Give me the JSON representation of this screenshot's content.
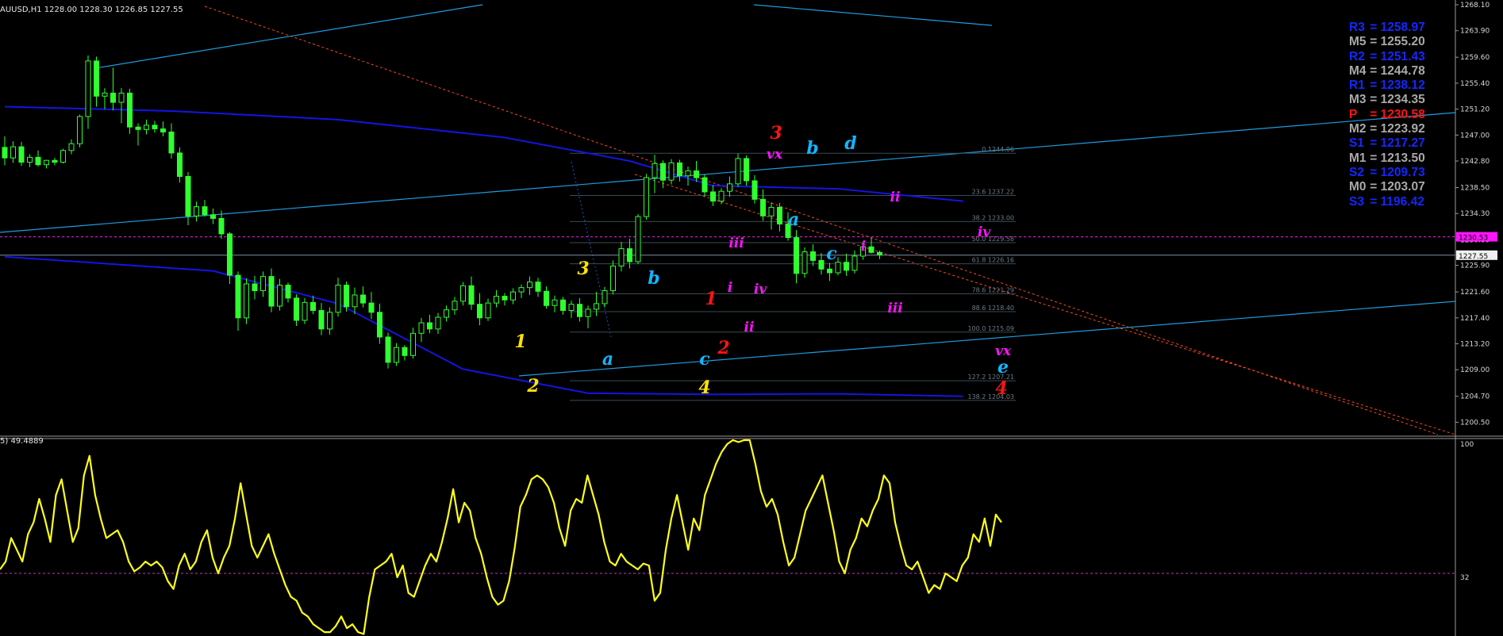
{
  "header": {
    "symbol_line": "AUUSD,H1  1228.00 1228.30 1226.85 1227.55",
    "indicator_line": "5) 49.4889"
  },
  "colors": {
    "background": "#000000",
    "candle": "#2fff2f",
    "moving_average": "#1414e6",
    "channel": "#1e9be0",
    "trend_dash": "#ff4a1a",
    "fib": "#3a4a54",
    "rsi": "#ffff1a",
    "wave_yellow": "#ffe400",
    "wave_cyan": "#12b6ff",
    "wave_red": "#ff1414",
    "wave_magenta": "#ff14ff",
    "pivot_blue": "#1428ff",
    "pivot_gray": "#a9a9a9",
    "pivot_red": "#ff1414"
  },
  "pivot_levels": [
    {
      "label": "R3",
      "value": "= 1258.97",
      "color": "#1428ff"
    },
    {
      "label": "M5",
      "value": "= 1255.20",
      "color": "#a9a9a9"
    },
    {
      "label": "R2",
      "value": "= 1251.43",
      "color": "#1428ff"
    },
    {
      "label": "M4",
      "value": "= 1244.78",
      "color": "#a9a9a9"
    },
    {
      "label": "R1",
      "value": "= 1238.12",
      "color": "#1428ff"
    },
    {
      "label": "M3",
      "value": "= 1234.35",
      "color": "#a9a9a9"
    },
    {
      "label": "P",
      "value": "= 1230.58",
      "color": "#ff1414"
    },
    {
      "label": "M2",
      "value": "= 1223.92",
      "color": "#a9a9a9"
    },
    {
      "label": "S1",
      "value": "= 1217.27",
      "color": "#1428ff"
    },
    {
      "label": "M1",
      "value": "= 1213.50",
      "color": "#a9a9a9"
    },
    {
      "label": "S2",
      "value": "= 1209.73",
      "color": "#1428ff"
    },
    {
      "label": "M0",
      "value": "= 1203.07",
      "color": "#a9a9a9"
    },
    {
      "label": "S3",
      "value": "= 1196.42",
      "color": "#1428ff"
    }
  ],
  "chart_data": [
    {
      "type": "candlestick",
      "timeframe": "H1",
      "ylim": [
        1198.5,
        1268.1
      ],
      "y_ticks": [
        "1268.10",
        "1263.90",
        "1259.60",
        "1255.40",
        "1251.20",
        "1247.00",
        "1242.80",
        "1238.50",
        "1234.30",
        "1230.00",
        "1225.90",
        "1221.60",
        "1217.40",
        "1213.20",
        "1209.00",
        "1204.70",
        "1200.50"
      ],
      "current_price": "1227.55",
      "pivot_price": "1230.53",
      "candles_ohlc": [
        [
          1245.0,
          1246.8,
          1242.1,
          1243.3
        ],
        [
          1243.3,
          1246.0,
          1242.5,
          1245.1
        ],
        [
          1245.1,
          1245.9,
          1242.0,
          1242.6
        ],
        [
          1242.6,
          1243.9,
          1241.8,
          1243.4
        ],
        [
          1243.4,
          1244.5,
          1241.9,
          1242.2
        ],
        [
          1242.2,
          1243.0,
          1241.6,
          1242.9
        ],
        [
          1242.9,
          1243.3,
          1242.1,
          1242.6
        ],
        [
          1242.6,
          1244.8,
          1242.4,
          1244.5
        ],
        [
          1244.5,
          1246.3,
          1243.9,
          1245.6
        ],
        [
          1245.6,
          1250.3,
          1245.0,
          1250.0
        ],
        [
          1250.0,
          1259.9,
          1248.0,
          1259.0
        ],
        [
          1259.0,
          1259.7,
          1251.6,
          1253.3
        ],
        [
          1253.3,
          1254.6,
          1251.2,
          1253.8
        ],
        [
          1253.8,
          1257.9,
          1251.0,
          1252.3
        ],
        [
          1252.3,
          1254.6,
          1248.9,
          1253.8
        ],
        [
          1253.8,
          1254.5,
          1247.2,
          1248.3
        ],
        [
          1248.3,
          1248.9,
          1245.3,
          1247.9
        ],
        [
          1247.9,
          1249.5,
          1247.1,
          1248.6
        ],
        [
          1248.6,
          1249.3,
          1247.4,
          1248.0
        ],
        [
          1248.0,
          1249.2,
          1246.8,
          1247.5
        ],
        [
          1247.5,
          1248.9,
          1243.2,
          1244.1
        ],
        [
          1244.1,
          1245.0,
          1239.3,
          1240.3
        ],
        [
          1240.3,
          1241.0,
          1232.4,
          1233.9
        ],
        [
          1233.9,
          1236.2,
          1233.0,
          1235.4
        ],
        [
          1235.4,
          1236.5,
          1233.8,
          1234.1
        ],
        [
          1234.1,
          1235.1,
          1232.6,
          1233.5
        ],
        [
          1233.5,
          1234.8,
          1230.2,
          1231.0
        ],
        [
          1231.0,
          1231.3,
          1222.9,
          1224.3
        ],
        [
          1224.3,
          1224.9,
          1215.3,
          1217.4
        ],
        [
          1217.4,
          1223.8,
          1216.4,
          1222.9
        ],
        [
          1222.9,
          1224.2,
          1220.4,
          1221.8
        ],
        [
          1221.8,
          1224.9,
          1220.8,
          1224.1
        ],
        [
          1224.1,
          1225.4,
          1218.3,
          1219.3
        ],
        [
          1219.3,
          1223.7,
          1218.6,
          1222.7
        ],
        [
          1222.7,
          1223.1,
          1219.9,
          1220.6
        ],
        [
          1220.6,
          1221.2,
          1216.1,
          1217.0
        ],
        [
          1217.0,
          1220.6,
          1216.4,
          1219.9
        ],
        [
          1219.9,
          1221.0,
          1218.0,
          1218.6
        ],
        [
          1218.6,
          1219.8,
          1214.6,
          1215.6
        ],
        [
          1215.6,
          1219.1,
          1214.7,
          1218.3
        ],
        [
          1218.3,
          1223.9,
          1217.6,
          1222.7
        ],
        [
          1222.7,
          1223.3,
          1218.4,
          1219.2
        ],
        [
          1219.2,
          1222.3,
          1218.0,
          1221.1
        ],
        [
          1221.1,
          1222.5,
          1219.1,
          1219.8
        ],
        [
          1219.8,
          1221.6,
          1217.2,
          1218.3
        ],
        [
          1218.3,
          1219.7,
          1213.2,
          1214.3
        ],
        [
          1214.3,
          1215.0,
          1209.2,
          1210.2
        ],
        [
          1210.2,
          1213.3,
          1209.6,
          1212.6
        ],
        [
          1212.6,
          1213.0,
          1210.5,
          1211.3
        ],
        [
          1211.3,
          1215.8,
          1210.8,
          1214.9
        ],
        [
          1214.9,
          1217.4,
          1213.5,
          1216.6
        ],
        [
          1216.6,
          1217.9,
          1214.9,
          1215.6
        ],
        [
          1215.6,
          1218.2,
          1214.8,
          1217.5
        ],
        [
          1217.5,
          1219.4,
          1216.8,
          1218.7
        ],
        [
          1218.7,
          1220.8,
          1217.9,
          1220.1
        ],
        [
          1220.1,
          1223.2,
          1219.4,
          1222.6
        ],
        [
          1222.6,
          1224.1,
          1218.7,
          1219.6
        ],
        [
          1219.6,
          1221.4,
          1216.2,
          1217.4
        ],
        [
          1217.4,
          1220.5,
          1216.9,
          1219.8
        ],
        [
          1219.8,
          1221.9,
          1219.1,
          1220.9
        ],
        [
          1220.9,
          1221.4,
          1219.4,
          1220.3
        ],
        [
          1220.3,
          1222.2,
          1219.6,
          1221.6
        ],
        [
          1221.6,
          1222.8,
          1220.6,
          1222.3
        ],
        [
          1222.3,
          1224.1,
          1221.1,
          1223.2
        ],
        [
          1223.2,
          1223.9,
          1220.8,
          1221.7
        ],
        [
          1221.7,
          1222.5,
          1218.9,
          1219.4
        ],
        [
          1219.4,
          1221.0,
          1218.3,
          1220.3
        ],
        [
          1220.3,
          1220.8,
          1217.9,
          1218.6
        ],
        [
          1218.6,
          1220.2,
          1217.4,
          1219.6
        ],
        [
          1219.6,
          1220.6,
          1216.8,
          1217.6
        ],
        [
          1217.6,
          1219.4,
          1215.7,
          1218.8
        ],
        [
          1218.8,
          1221.6,
          1217.7,
          1219.7
        ],
        [
          1219.7,
          1222.4,
          1219.1,
          1221.8
        ],
        [
          1221.8,
          1226.7,
          1221.2,
          1225.8
        ],
        [
          1225.8,
          1229.7,
          1224.9,
          1228.6
        ],
        [
          1228.6,
          1230.2,
          1225.4,
          1226.5
        ],
        [
          1226.5,
          1234.2,
          1226.1,
          1233.8
        ],
        [
          1233.8,
          1240.7,
          1233.3,
          1240.1
        ],
        [
          1240.1,
          1243.8,
          1237.6,
          1242.4
        ],
        [
          1242.4,
          1242.9,
          1238.4,
          1239.7
        ],
        [
          1239.7,
          1243.1,
          1239.0,
          1242.5
        ],
        [
          1242.5,
          1243.0,
          1239.5,
          1240.4
        ],
        [
          1240.4,
          1241.9,
          1238.8,
          1241.2
        ],
        [
          1241.2,
          1242.8,
          1239.4,
          1240.1
        ],
        [
          1240.1,
          1240.6,
          1237.1,
          1237.8
        ],
        [
          1237.8,
          1238.9,
          1235.5,
          1236.3
        ],
        [
          1236.3,
          1238.4,
          1235.8,
          1237.9
        ],
        [
          1237.9,
          1240.3,
          1237.0,
          1239.1
        ],
        [
          1239.1,
          1244.0,
          1238.6,
          1243.2
        ],
        [
          1243.2,
          1243.7,
          1238.8,
          1239.6
        ],
        [
          1239.6,
          1240.5,
          1235.9,
          1236.6
        ],
        [
          1236.6,
          1238.2,
          1233.1,
          1233.9
        ],
        [
          1233.9,
          1236.1,
          1231.7,
          1235.3
        ],
        [
          1235.3,
          1236.0,
          1231.4,
          1232.6
        ],
        [
          1232.6,
          1234.5,
          1229.9,
          1230.4
        ],
        [
          1230.4,
          1231.6,
          1223.0,
          1224.6
        ],
        [
          1224.6,
          1228.8,
          1223.9,
          1228.1
        ],
        [
          1228.1,
          1229.3,
          1225.8,
          1226.7
        ],
        [
          1226.7,
          1227.9,
          1224.4,
          1225.3
        ],
        [
          1225.3,
          1226.3,
          1223.4,
          1224.7
        ],
        [
          1224.7,
          1227.2,
          1224.3,
          1226.4
        ],
        [
          1226.4,
          1227.8,
          1224.2,
          1225.1
        ],
        [
          1225.1,
          1228.3,
          1224.6,
          1227.4
        ],
        [
          1227.4,
          1229.6,
          1226.8,
          1228.9
        ],
        [
          1228.9,
          1230.4,
          1227.8,
          1228.0
        ],
        [
          1228.0,
          1228.3,
          1226.9,
          1227.6
        ]
      ],
      "moving_averages": [
        {
          "points": [
            [
              0,
              1251.6
            ],
            [
              20,
              1250.9
            ],
            [
              40,
              1249.5
            ],
            [
              60,
              1246.6
            ],
            [
              75,
              1242.8
            ],
            [
              85,
              1238.8
            ],
            [
              100,
              1238.3
            ],
            [
              115,
              1236.3
            ]
          ]
        },
        {
          "points": [
            [
              0,
              1227.3
            ],
            [
              25,
              1225.0
            ],
            [
              40,
              1219.7
            ],
            [
              55,
              1209.1
            ],
            [
              70,
              1205.2
            ],
            [
              85,
              1205.0
            ],
            [
              100,
              1205.1
            ],
            [
              115,
              1204.7
            ]
          ]
        }
      ],
      "fibonacci": {
        "levels": [
          {
            "label": "0 1244.06",
            "price": 1244.06
          },
          {
            "label": "23.6 1237.22",
            "price": 1237.22
          },
          {
            "label": "38.2 1233.00",
            "price": 1233.0
          },
          {
            "label": "50.0 1229.58",
            "price": 1229.58
          },
          {
            "label": "61.8 1226.16",
            "price": 1226.16
          },
          {
            "label": "78.6 1221.29",
            "price": 1221.29
          },
          {
            "label": "88.6 1218.40",
            "price": 1218.4
          },
          {
            "label": "100.0 1215.09",
            "price": 1215.09
          },
          {
            "label": "127.2 1207.21",
            "price": 1207.21
          },
          {
            "label": "138.2 1204.03",
            "price": 1204.03
          }
        ]
      },
      "wave_labels": [
        {
          "text": "3",
          "color": "#ffe400"
        },
        {
          "text": "1",
          "color": "#ffe400"
        },
        {
          "text": "2",
          "color": "#ffe400"
        },
        {
          "text": "4",
          "color": "#ffe400"
        },
        {
          "text": "a",
          "color": "#12b6ff"
        },
        {
          "text": "b",
          "color": "#12b6ff"
        },
        {
          "text": "c",
          "color": "#12b6ff"
        },
        {
          "text": "a",
          "color": "#12b6ff"
        },
        {
          "text": "b",
          "color": "#12b6ff"
        },
        {
          "text": "c",
          "color": "#12b6ff"
        },
        {
          "text": "d",
          "color": "#12b6ff"
        },
        {
          "text": "e",
          "color": "#12b6ff"
        },
        {
          "text": "1",
          "color": "#ff1414"
        },
        {
          "text": "2",
          "color": "#ff1414"
        },
        {
          "text": "3",
          "color": "#ff1414"
        },
        {
          "text": "4",
          "color": "#ff1414"
        },
        {
          "text": "i",
          "color": "#ff14ff"
        },
        {
          "text": "ii",
          "color": "#ff14ff"
        },
        {
          "text": "iii",
          "color": "#ff14ff"
        },
        {
          "text": "iv",
          "color": "#ff14ff"
        },
        {
          "text": "vx",
          "color": "#ff14ff"
        },
        {
          "text": "i",
          "color": "#ff14ff"
        },
        {
          "text": "ii",
          "color": "#ff14ff"
        },
        {
          "text": "iii",
          "color": "#ff14ff"
        },
        {
          "text": "iv",
          "color": "#ff14ff"
        },
        {
          "text": "vx",
          "color": "#ff14ff"
        }
      ]
    },
    {
      "type": "line",
      "ylim": [
        0,
        100
      ],
      "y_ticks": [
        "100",
        "32"
      ],
      "level_line": 32,
      "current_value": "49.4889",
      "values": [
        34,
        38,
        50,
        44,
        38,
        52,
        58,
        70,
        60,
        48,
        72,
        80,
        64,
        48,
        55,
        82,
        92,
        72,
        60,
        50,
        52,
        54,
        48,
        38,
        33,
        35,
        38,
        36,
        38,
        35,
        28,
        24,
        36,
        42,
        34,
        38,
        48,
        54,
        40,
        32,
        40,
        46,
        60,
        78,
        62,
        46,
        40,
        46,
        52,
        42,
        34,
        26,
        20,
        18,
        12,
        10,
        6,
        4,
        2,
        2,
        5,
        10,
        4,
        6,
        2,
        1,
        20,
        34,
        36,
        38,
        42,
        30,
        36,
        22,
        20,
        28,
        36,
        42,
        38,
        48,
        60,
        75,
        58,
        68,
        64,
        50,
        42,
        30,
        20,
        16,
        18,
        28,
        45,
        66,
        72,
        80,
        82,
        80,
        76,
        68,
        55,
        46,
        64,
        70,
        68,
        82,
        72,
        62,
        48,
        38,
        36,
        42,
        38,
        36,
        34,
        37,
        36,
        18,
        22,
        44,
        60,
        72,
        58,
        44,
        60,
        54,
        72,
        80,
        88,
        94,
        98,
        100,
        99,
        100,
        100,
        88,
        74,
        66,
        70,
        62,
        48,
        36,
        40,
        52,
        64,
        70,
        76,
        82,
        68,
        54,
        38,
        32,
        44,
        50,
        60,
        56,
        64,
        70,
        82,
        78,
        58,
        46,
        36,
        34,
        38,
        30,
        22,
        26,
        24,
        32,
        30,
        28,
        36,
        40,
        52,
        48,
        60,
        46,
        62,
        58
      ]
    }
  ]
}
